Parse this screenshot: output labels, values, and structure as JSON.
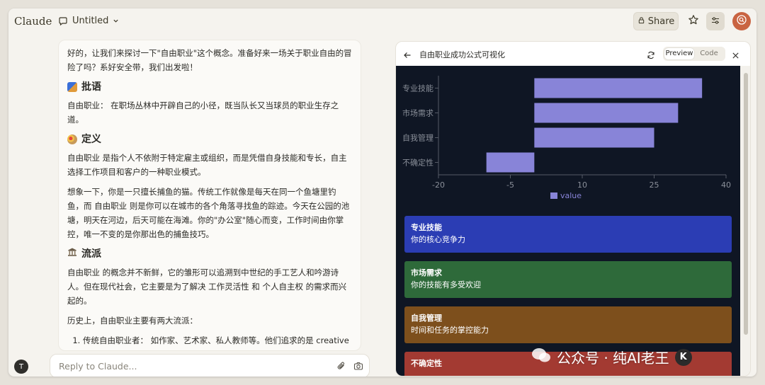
{
  "app": {
    "brand": "Claude",
    "title": "Untitled",
    "share_label": "Share"
  },
  "chat": {
    "intro": "好的，让我们来探讨一下\"自由职业\"这个概念。准备好来一场关于职业自由的冒险了吗？系好安全带，我们出发啦！",
    "sections": [
      {
        "heading": "批语",
        "icon": "theater-icon",
        "paras": [
          "自由职业： 在职场丛林中开辟自己的小径，既当队长又当球员的职业生存之道。"
        ]
      },
      {
        "heading": "定义",
        "icon": "palette-icon",
        "paras": [
          "自由职业 是指个人不依附于特定雇主或组织，而是凭借自身技能和专长，自主选择工作项目和客户的一种职业模式。",
          "想象一下，你是一只擅长捕鱼的猫。传统工作就像是每天在同一个鱼塘里钓鱼，而 自由职业 则是你可以在城市的各个角落寻找鱼的踪迹。今天在公园的池塘，明天在河边，后天可能在海滩。你的\"办公室\"随心而变，工作时间由你掌控，唯一不变的是你那出色的捕鱼技巧。"
        ]
      },
      {
        "heading": "流派",
        "icon": "classical-building-icon",
        "paras": [
          "自由职业 的概念并不新鲜，它的雏形可以追溯到中世纪的手工艺人和吟游诗人。但在现代社会，它主要是为了解决 工作灵活性 和 个人自主权 的需求而兴起的。",
          "历史上，自由职业主要有两大流派："
        ]
      }
    ],
    "list": [
      "传统自由职业者： 如作家、艺术家、私人教师等。他们追求的是 creative freedom，工作内容往往与个人兴趣高度吻合。"
    ],
    "reply_placeholder": "Reply to Claude...",
    "user_initial": "T"
  },
  "artifact": {
    "title": "自由职业成功公式可视化",
    "preview_label": "Preview",
    "code_label": "Code",
    "cards": [
      {
        "title": "专业技能",
        "subtitle": "你的核心竞争力",
        "color": "#2b3db4"
      },
      {
        "title": "市场需求",
        "subtitle": "你的技能有多受欢迎",
        "color": "#2e6a3a"
      },
      {
        "title": "自我管理",
        "subtitle": "时间和任务的掌控能力",
        "color": "#7d4f1c"
      },
      {
        "title": "不确定性",
        "subtitle": "",
        "color": "#a33a32"
      }
    ]
  },
  "chart_data": {
    "type": "bar",
    "orientation": "horizontal",
    "categories": [
      "专业技能",
      "市场需求",
      "自我管理",
      "不确定性"
    ],
    "series": [
      {
        "name": "value",
        "values": [
          35,
          30,
          25,
          -10
        ],
        "base": 0
      }
    ],
    "xlim": [
      -20,
      40
    ],
    "xticks": [
      "-20",
      "-5",
      "10",
      "25",
      "40"
    ],
    "legend": "bottom",
    "bar_color": "#8884d8"
  },
  "watermark": {
    "text": "公众号 · 纯AI老王",
    "logo": "K"
  }
}
